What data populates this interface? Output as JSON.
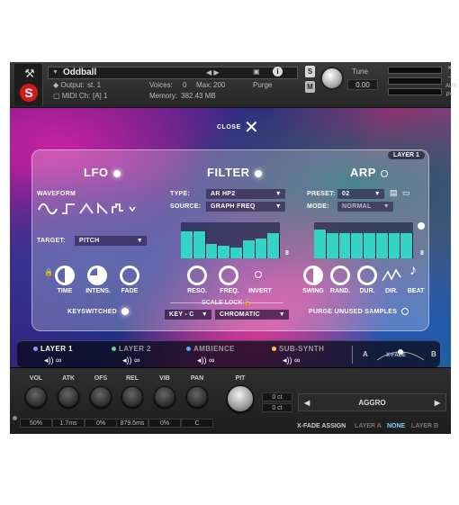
{
  "header": {
    "wrench_icon": "wrench-icon",
    "logo_letter": "S",
    "instrument_name": "Oddball",
    "output_label": "Output:",
    "output_value": "st. 1",
    "voices_label": "Voices:",
    "voices_value": "0",
    "max_label": "Max:",
    "max_value": "200",
    "purge_label": "Purge",
    "midi_label": "MIDI Ch:",
    "midi_value": "[A]  1",
    "memory_label": "Memory:",
    "memory_value": "382.43 MB",
    "solo": "S",
    "mute": "M",
    "tune_label": "Tune",
    "tune_value": "0.00",
    "aux": "AUX",
    "pv": "PV"
  },
  "overlay": {
    "close_label": "CLOSE",
    "layer_badge": "LAYER 1"
  },
  "lfo": {
    "title": "LFO",
    "waveform_label": "WAVEFORM",
    "target_label": "TARGET:",
    "target_value": "PITCH",
    "knobs": [
      "TIME",
      "INTENS.",
      "FADE"
    ],
    "keyswitched_label": "KEYSWITCHED"
  },
  "filter": {
    "title": "FILTER",
    "type_label": "TYPE:",
    "type_value": "AR HP2",
    "source_label": "SOURCE:",
    "source_value": "GRAPH FREQ",
    "step_count": "8",
    "steps": [
      0.75,
      0.75,
      0.4,
      0.35,
      0.3,
      0.5,
      0.55,
      0.7
    ],
    "knobs": [
      "RESO.",
      "FREQ.",
      "INVERT"
    ],
    "scale_lock_label": "SCALE LOCK",
    "key_value": "KEY - C",
    "scale_value": "CHROMATIC"
  },
  "arp": {
    "title": "ARP",
    "preset_label": "PRESET:",
    "preset_value": "02",
    "mode_label": "MODE:",
    "mode_value": "NORMAL",
    "step_count": "8",
    "steps": [
      0.8,
      0.7,
      0.7,
      0.7,
      0.7,
      0.7,
      0.7,
      0.7
    ],
    "knobs": [
      "SWING",
      "RAND.",
      "DUR.",
      "DIR.",
      "BEAT"
    ],
    "purge_label": "PURGE UNUSED SAMPLES"
  },
  "layers": [
    {
      "label": "LAYER 1",
      "color": "#9b8cff"
    },
    {
      "label": "LAYER 2",
      "color": "#6bd17a"
    },
    {
      "label": "AMBIENCE",
      "color": "#4fb0ff"
    },
    {
      "label": "SUB-SYNTH",
      "color": "#ffc53d"
    }
  ],
  "xfade": {
    "a": "A",
    "label": "X-FADE",
    "b": "B"
  },
  "bottom": {
    "knobs": [
      {
        "label": "VOL",
        "value": "50%"
      },
      {
        "label": "ATK",
        "value": "1.7ms"
      },
      {
        "label": "OFS",
        "value": "0%"
      },
      {
        "label": "REL",
        "value": "879.5ms"
      },
      {
        "label": "VIB",
        "value": "0%"
      },
      {
        "label": "PAN",
        "value": "C"
      },
      {
        "label": "PIT",
        "value": ""
      }
    ],
    "pitch_ct_1": "0 ct",
    "pitch_ct_2": "0 ct",
    "preset_name": "AGGRO",
    "xfade_assign_label": "X-FADE ASSIGN",
    "xfade_options": [
      "LAYER A",
      "NONE",
      "LAYER B"
    ]
  },
  "colors": {
    "accent_teal": "#33d4c6",
    "brand_red": "#d11b1b"
  }
}
